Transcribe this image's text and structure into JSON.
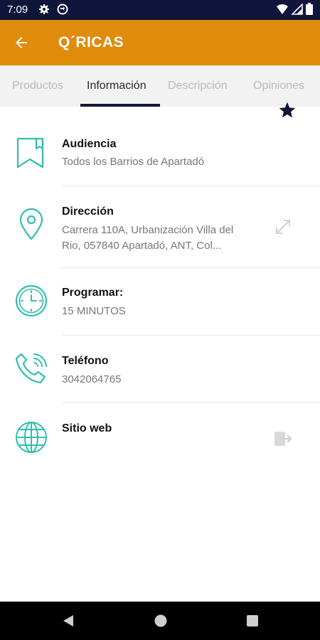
{
  "status_bar": {
    "time": "7:09",
    "left_icons": [
      "gear-icon",
      "sync-icon"
    ],
    "right_icons": [
      "wifi-icon",
      "signal-icon",
      "battery-icon"
    ]
  },
  "app_bar": {
    "title": "Q´RICAS",
    "back_icon": "back-arrow-icon",
    "color": "#df8b0b"
  },
  "tabs": [
    {
      "label": "Productos",
      "active": false
    },
    {
      "label": "Información",
      "active": true
    },
    {
      "label": "Descripción",
      "active": false
    },
    {
      "label": "Opiniones",
      "active": false
    }
  ],
  "accent_color": "#10153b",
  "icon_color": "#2fc0ad",
  "info_rows": [
    {
      "icon": "bookmark-icon",
      "title": "Audiencia",
      "subtitle": "Todos los Barrios de Apartadó"
    },
    {
      "icon": "location-pin-icon",
      "title": "Dirección",
      "subtitle": "Carrera 110A, Urbanización Villa del Rio, 057840 Apartadó, ANT, Col...",
      "action_icon": "expand-icon"
    },
    {
      "icon": "clock-icon",
      "title": "Programar:",
      "subtitle": "15 MINUTOS"
    },
    {
      "icon": "phone-icon",
      "title": "Teléfono",
      "subtitle": "3042064765"
    },
    {
      "icon": "globe-icon",
      "title": "Sitio web",
      "subtitle": "",
      "action_icon": "open-external-icon"
    }
  ],
  "nav_bar": {
    "buttons": [
      "back-triangle-icon",
      "home-circle-icon",
      "recents-square-icon"
    ]
  }
}
